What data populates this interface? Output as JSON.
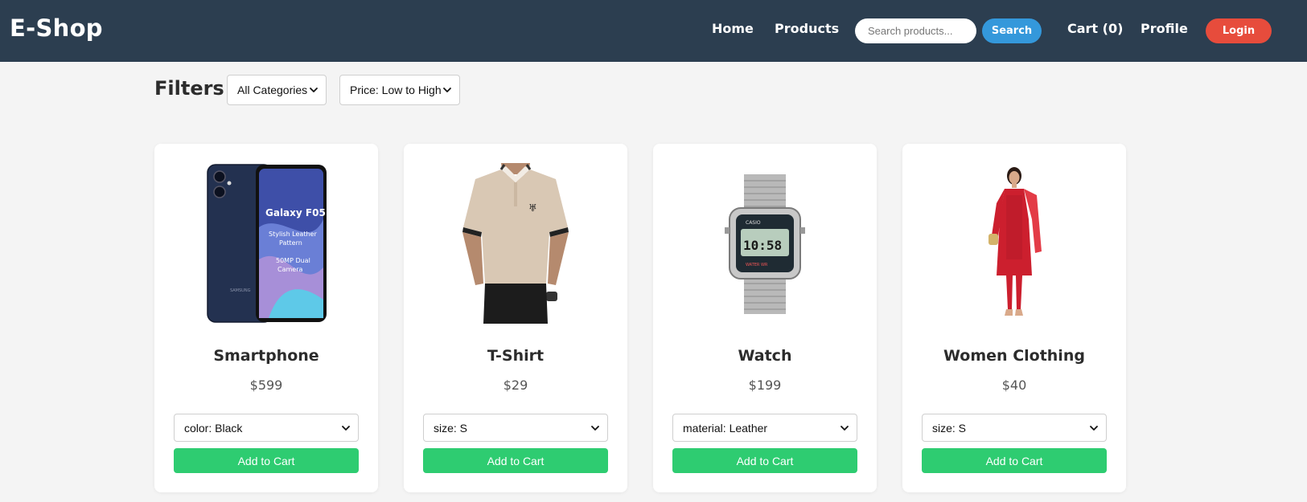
{
  "header": {
    "brand": "E-Shop",
    "nav": {
      "home": "Home",
      "products": "Products",
      "cart": "Cart (0)",
      "profile": "Profile"
    },
    "search": {
      "placeholder": "Search products...",
      "button": "Search"
    },
    "login": "Login",
    "colors": {
      "bar": "#2c3e50",
      "search_button": "#3498db",
      "login_button": "#e74c3c"
    }
  },
  "filters": {
    "title": "Filters",
    "category": "All Categories",
    "price_sort": "Price: Low to High"
  },
  "products": [
    {
      "name": "Smartphone",
      "price": "$599",
      "variant": "color: Black",
      "button": "Add to Cart",
      "image": "smartphone-photo"
    },
    {
      "name": "T-Shirt",
      "price": "$29",
      "variant": "size: S",
      "button": "Add to Cart",
      "image": "t-shirt-photo"
    },
    {
      "name": "Watch",
      "price": "$199",
      "variant": "material: Leather",
      "button": "Add to Cart",
      "image": "watch-photo"
    },
    {
      "name": "Women Clothing",
      "price": "$40",
      "variant": "size: S",
      "button": "Add to Cart",
      "image": "women-clothing-photo"
    }
  ],
  "colors": {
    "add_to_cart": "#2ecc71",
    "page_background": "#f4f4f4"
  }
}
